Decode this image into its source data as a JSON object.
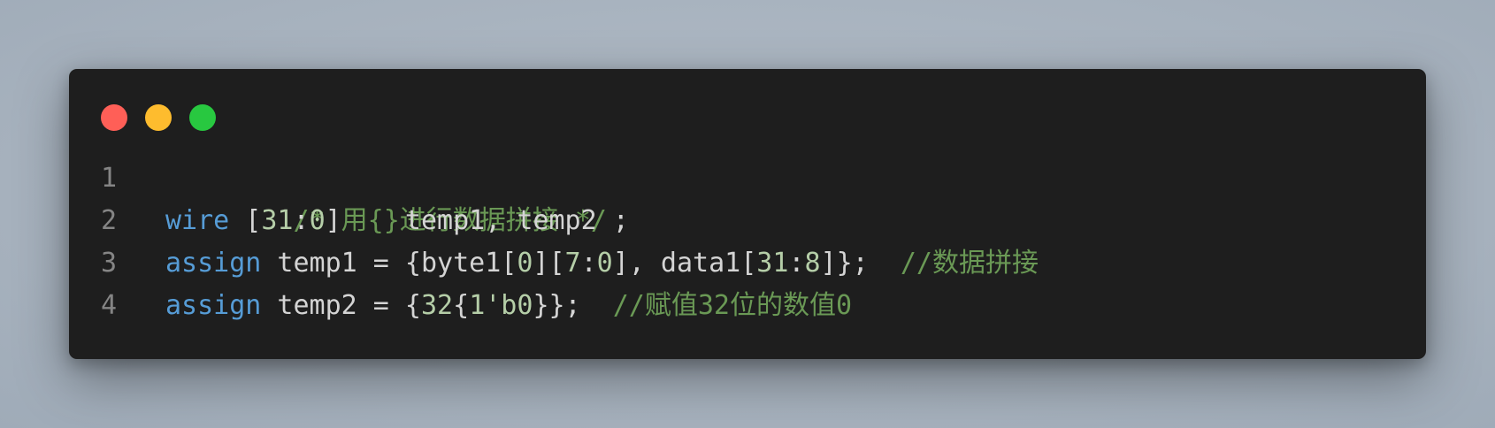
{
  "window": {
    "traffic_lights": {
      "close_color": "#ff5f57",
      "minimize_color": "#febc2e",
      "zoom_color": "#28c840"
    }
  },
  "code": {
    "lines": [
      {
        "number": "1",
        "tokens": [
          {
            "type": "comment",
            "text": "/* 用{}进行数据拼接 */"
          }
        ]
      },
      {
        "number": "2",
        "tokens": [
          {
            "type": "keyword",
            "text": "wire"
          },
          {
            "type": "plain",
            "text": " ["
          },
          {
            "type": "number",
            "text": "31"
          },
          {
            "type": "plain",
            "text": ":"
          },
          {
            "type": "number",
            "text": "0"
          },
          {
            "type": "plain",
            "text": "]    temp1, temp2 ;"
          }
        ]
      },
      {
        "number": "3",
        "tokens": [
          {
            "type": "keyword",
            "text": "assign"
          },
          {
            "type": "plain",
            "text": " temp1 = {byte1["
          },
          {
            "type": "number",
            "text": "0"
          },
          {
            "type": "plain",
            "text": "]["
          },
          {
            "type": "number",
            "text": "7"
          },
          {
            "type": "plain",
            "text": ":"
          },
          {
            "type": "number",
            "text": "0"
          },
          {
            "type": "plain",
            "text": "], data1["
          },
          {
            "type": "number",
            "text": "31"
          },
          {
            "type": "plain",
            "text": ":"
          },
          {
            "type": "number",
            "text": "8"
          },
          {
            "type": "plain",
            "text": "]};  "
          },
          {
            "type": "comment",
            "text": "//数据拼接"
          }
        ]
      },
      {
        "number": "4",
        "tokens": [
          {
            "type": "keyword",
            "text": "assign"
          },
          {
            "type": "plain",
            "text": " temp2 = {"
          },
          {
            "type": "number",
            "text": "32"
          },
          {
            "type": "plain",
            "text": "{"
          },
          {
            "type": "number",
            "text": "1'b0"
          },
          {
            "type": "plain",
            "text": "}};  "
          },
          {
            "type": "comment",
            "text": "//赋值32位的数值0"
          }
        ]
      }
    ]
  }
}
